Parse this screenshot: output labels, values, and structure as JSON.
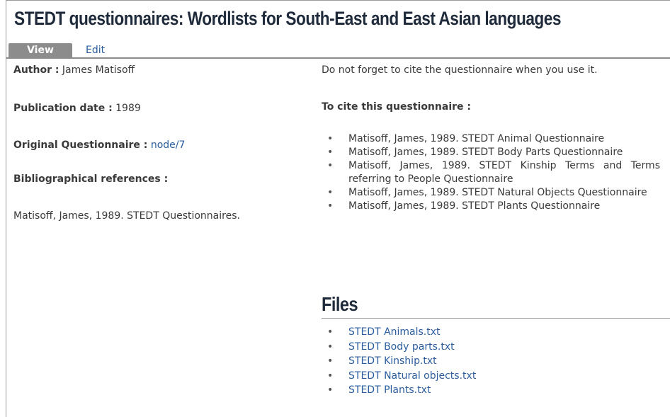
{
  "title": "STEDT questionnaires: Wordlists for South-East and East Asian languages",
  "tabs": {
    "view": "View",
    "edit": "Edit"
  },
  "fields": {
    "author_label": "Author :",
    "author_value": "James Matisoff",
    "pubdate_label": "Publication date :",
    "pubdate_value": "1989",
    "orig_label": "Original Questionnaire :",
    "orig_value": "node/7",
    "biblio_label": "Bibliographical references :",
    "biblio_value": "Matisoff, James, 1989. STEDT Questionnaires."
  },
  "cite": {
    "note": "Do not forget to cite the questionnaire when you use it.",
    "heading": "To cite this questionnaire :",
    "items": [
      "Matisoff, James, 1989. STEDT Animal Questionnaire",
      "Matisoff, James, 1989. STEDT Body Parts Questionnaire",
      "Matisoff, James, 1989. STEDT Kinship Terms and Terms referring to People Questionnaire",
      "Matisoff, James, 1989. STEDT Natural Objects Questionnaire",
      "Matisoff, James, 1989. STEDT Plants Questionnaire"
    ]
  },
  "files": {
    "heading": "Files",
    "items": [
      "STEDT Animals.txt",
      "STEDT Body parts.txt",
      "STEDT Kinship.txt",
      "STEDT Natural objects.txt",
      "STEDT Plants.txt"
    ]
  },
  "colors": {
    "link": "#2a5d9f",
    "tab_bg": "#8c8c8c",
    "heading": "#1f2a3a"
  }
}
